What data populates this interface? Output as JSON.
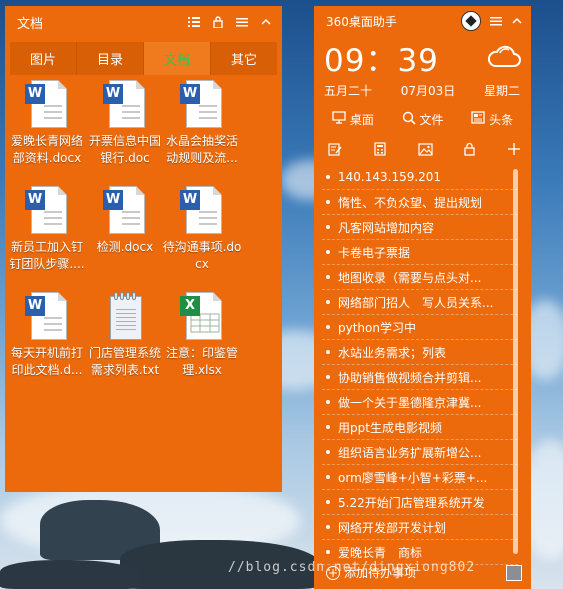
{
  "file_fence": {
    "title": "文档",
    "tabs": [
      {
        "label": "图片",
        "active": false
      },
      {
        "label": "目录",
        "active": false
      },
      {
        "label": "文档",
        "active": true
      },
      {
        "label": "其它",
        "active": false
      }
    ],
    "files": [
      {
        "name": "爱晚长青网络部资料.docx",
        "type": "word-icon"
      },
      {
        "name": "开票信息中国银行.doc",
        "type": "word-icon"
      },
      {
        "name": "水晶会抽奖活动规则及流...",
        "type": "word-icon"
      },
      {
        "name": "新员工加入钉钉团队步骤....",
        "type": "word-icon"
      },
      {
        "name": "检测.docx",
        "type": "word-icon"
      },
      {
        "name": "待沟通事项.docx",
        "type": "word-icon"
      },
      {
        "name": "每天开机前打印此文档.d...",
        "type": "word-icon"
      },
      {
        "name": "门店管理系统需求列表.txt",
        "type": "text-file-icon"
      },
      {
        "name": "注意：印鉴管理.xlsx",
        "type": "excel-icon"
      }
    ]
  },
  "widget": {
    "title": "360桌面助手",
    "time": "09：39",
    "lunar_date": "五月二十",
    "date": "07月03日",
    "weekday": "星期二",
    "tabs": [
      {
        "label": "桌面",
        "icon": "monitor-icon"
      },
      {
        "label": "文件",
        "icon": "search-icon"
      },
      {
        "label": "头条",
        "icon": "news-icon"
      }
    ],
    "todos": [
      "140.143.159.201",
      "惰性、不负众望、提出规划",
      "凡客网站增加内容",
      "卡卷电子票据",
      "地图收录（需要与点头对...",
      "网络部门招人　写人员关系...",
      "python学习中",
      "水站业务需求；列表",
      "协助销售做视频合并剪辑...",
      "做一个关于墨德隆京津冀...",
      "用ppt生成电影视频",
      "组织语言业务扩展新增公...",
      "orm廖雪峰+小智+彩票+...",
      "5.22开始门店管理系统开发",
      "网络开发部开发计划",
      "爱晚长青　商标"
    ],
    "add_todo_label": "添加待办事项"
  },
  "watermark": "//blog.csdn.net/dingxiong802",
  "colors": {
    "accent": "#ec6a0b",
    "active_tab": "#36c25b"
  }
}
